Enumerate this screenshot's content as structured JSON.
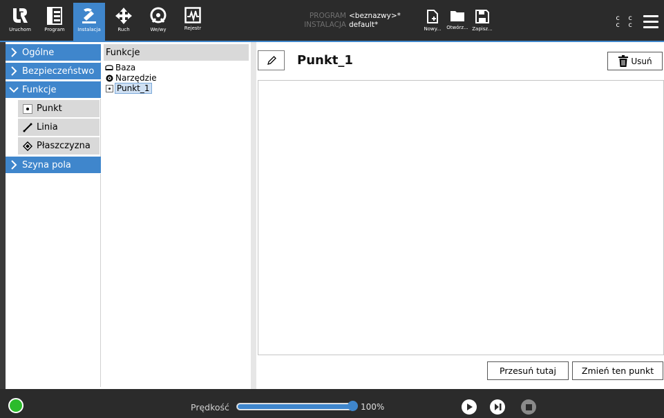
{
  "topbar": {
    "nav": [
      {
        "label": "Uruchom",
        "icon": "ur-logo-icon"
      },
      {
        "label": "Program",
        "icon": "program-icon"
      },
      {
        "label": "Instalacja",
        "icon": "installation-icon"
      },
      {
        "label": "Ruch",
        "icon": "move-icon"
      },
      {
        "label": "We/wy",
        "icon": "io-icon"
      },
      {
        "label": "Rejestr",
        "icon": "log-icon"
      }
    ],
    "program_key": "PROGRAM",
    "program_value": "<beznazwy>*",
    "installation_key": "INSTALACJA",
    "installation_value": "default*",
    "file_buttons": [
      {
        "label": "Nowy...",
        "icon": "new-file-icon"
      },
      {
        "label": "Otwórz...",
        "icon": "folder-icon"
      },
      {
        "label": "Zapisz...",
        "icon": "save-icon"
      }
    ],
    "cc_row1": "c c",
    "cc_row2": "c c"
  },
  "sidebar": {
    "items": [
      {
        "label": "Ogólne",
        "expanded": false
      },
      {
        "label": "Bezpieczeństwo",
        "expanded": false
      },
      {
        "label": "Funkcje",
        "expanded": true
      },
      {
        "label": "Szyna pola",
        "expanded": false
      }
    ],
    "sub_items": [
      {
        "label": "Punkt",
        "icon": "point-icon"
      },
      {
        "label": "Linia",
        "icon": "line-icon"
      },
      {
        "label": "Płaszczyzna",
        "icon": "plane-icon"
      }
    ]
  },
  "tree": {
    "header": "Funkcje",
    "items": [
      {
        "label": "Baza",
        "icon": "base-icon"
      },
      {
        "label": "Narzędzie",
        "icon": "tool-icon"
      },
      {
        "label": "Punkt_1",
        "icon": "point-icon",
        "selected": true
      }
    ]
  },
  "editor": {
    "feature_name": "Punkt_1",
    "delete_label": "Usuń",
    "move_here_label": "Przesuń tutaj",
    "change_point_label": "Zmień ten punkt"
  },
  "bottombar": {
    "speed_label": "Prędkość",
    "speed_value": "100%",
    "speed_fraction": 1.0,
    "status_color": "#2cbb2c"
  },
  "colors": {
    "accent": "#3f86cc",
    "topbar_bg": "#2b2b2b"
  }
}
